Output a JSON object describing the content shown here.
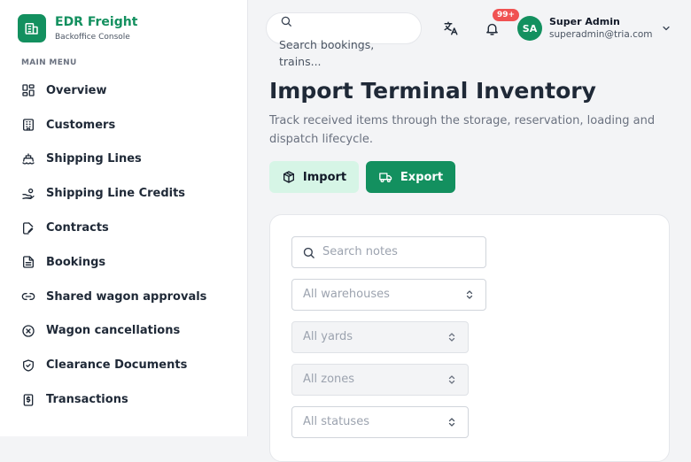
{
  "brand": {
    "title": "EDR Freight",
    "subtitle": "Backoffice Console"
  },
  "sidebar": {
    "section_label": "MAIN MENU",
    "items": [
      {
        "label": "Overview",
        "icon": "grid-icon"
      },
      {
        "label": "Customers",
        "icon": "building-icon"
      },
      {
        "label": "Shipping Lines",
        "icon": "ship-icon"
      },
      {
        "label": "Shipping Line Credits",
        "icon": "hand-coins-icon"
      },
      {
        "label": "Contracts",
        "icon": "file-edit-icon"
      },
      {
        "label": "Bookings",
        "icon": "file-text-icon"
      },
      {
        "label": "Shared wagon approvals",
        "icon": "link-icon"
      },
      {
        "label": "Wagon cancellations",
        "icon": "circle-x-icon"
      },
      {
        "label": "Clearance Documents",
        "icon": "shield-check-icon"
      },
      {
        "label": "Transactions",
        "icon": "receipt-dollar-icon"
      }
    ]
  },
  "header": {
    "search_placeholder": "Search bookings, trains...",
    "notification_count": "99+",
    "user": {
      "initials": "SA",
      "name": "Super Admin",
      "email": "superadmin@tria.com"
    }
  },
  "page": {
    "title": "Import Terminal Inventory",
    "subtitle": "Track received items through the storage, reservation, loading and dispatch lifecycle.",
    "import_label": "Import",
    "export_label": "Export"
  },
  "filters": {
    "search_notes_placeholder": "Search notes",
    "warehouse": "All warehouses",
    "yard": "All yards",
    "zone": "All zones",
    "status": "All statuses"
  },
  "colors": {
    "brand": "#13905f",
    "import_bg": "#d6f5e6",
    "badge": "#f05252"
  }
}
